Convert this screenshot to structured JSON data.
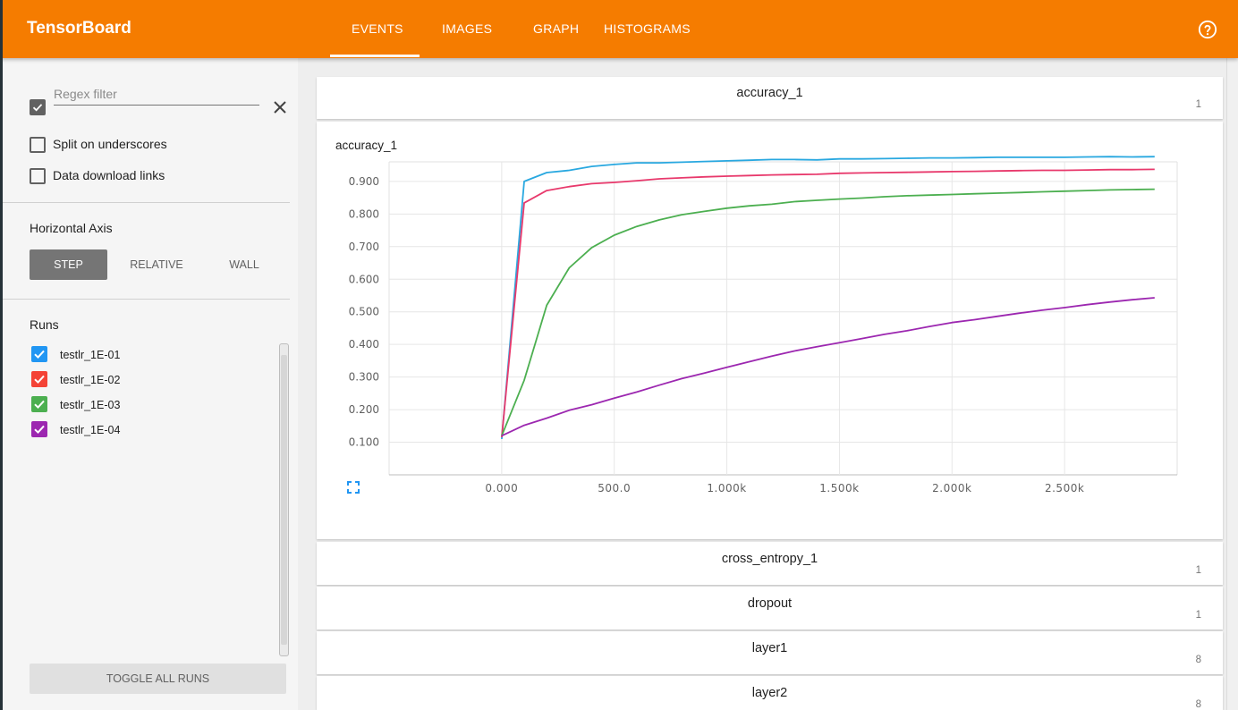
{
  "header": {
    "brand": "TensorBoard",
    "tabs": [
      {
        "label": "EVENTS",
        "active": true
      },
      {
        "label": "IMAGES",
        "active": false
      },
      {
        "label": "GRAPH",
        "active": false
      },
      {
        "label": "HISTOGRAMS",
        "active": false
      }
    ],
    "help_icon": "help-circle-icon",
    "accent_color": "#f57c00"
  },
  "sidebar": {
    "regex_placeholder": "Regex filter",
    "regex_checked": true,
    "options": [
      {
        "label": "Split on underscores",
        "checked": false
      },
      {
        "label": "Data download links",
        "checked": false
      }
    ],
    "horizontal_axis_title": "Horizontal Axis",
    "axis_buttons": [
      {
        "label": "STEP",
        "active": true
      },
      {
        "label": "RELATIVE",
        "active": false
      },
      {
        "label": "WALL",
        "active": false
      }
    ],
    "runs_title": "Runs",
    "runs": [
      {
        "label": "testlr_1E-01",
        "color": "#2196f3",
        "checked": true
      },
      {
        "label": "testlr_1E-02",
        "color": "#f44336",
        "checked": true
      },
      {
        "label": "testlr_1E-03",
        "color": "#4caf50",
        "checked": true
      },
      {
        "label": "testlr_1E-04",
        "color": "#9c27b0",
        "checked": true
      }
    ],
    "toggle_all_label": "TOGGLE ALL RUNS"
  },
  "categories": [
    {
      "title": "accuracy_1",
      "count": "1",
      "expanded": true
    },
    {
      "title": "cross_entropy_1",
      "count": "1",
      "expanded": false
    },
    {
      "title": "dropout",
      "count": "1",
      "expanded": false
    },
    {
      "title": "layer1",
      "count": "8",
      "expanded": false
    },
    {
      "title": "layer2",
      "count": "8",
      "expanded": false
    }
  ],
  "chart_data": {
    "type": "line",
    "title": "accuracy_1",
    "xlabel": "",
    "ylabel": "",
    "xlim": [
      -500,
      3000
    ],
    "ylim": [
      0.0,
      0.96
    ],
    "x_tick_labels": [
      "0.000",
      "500.0",
      "1.000k",
      "1.500k",
      "2.000k",
      "2.500k"
    ],
    "x_tick_values": [
      0,
      500,
      1000,
      1500,
      2000,
      2500
    ],
    "y_tick_labels": [
      "0.100",
      "0.200",
      "0.300",
      "0.400",
      "0.500",
      "0.600",
      "0.700",
      "0.800",
      "0.900"
    ],
    "y_tick_values": [
      0.1,
      0.2,
      0.3,
      0.4,
      0.5,
      0.6,
      0.7,
      0.8,
      0.9
    ],
    "grid": true,
    "series": [
      {
        "name": "testlr_1E-01",
        "color": "#29a8e0",
        "x": [
          0,
          100,
          200,
          300,
          400,
          500,
          600,
          700,
          800,
          900,
          1000,
          1100,
          1200,
          1300,
          1400,
          1500,
          1600,
          1700,
          1800,
          1900,
          2000,
          2100,
          2200,
          2300,
          2400,
          2500,
          2600,
          2700,
          2800,
          2900
        ],
        "y": [
          0.11,
          0.9,
          0.927,
          0.934,
          0.946,
          0.952,
          0.957,
          0.957,
          0.959,
          0.961,
          0.963,
          0.965,
          0.967,
          0.967,
          0.966,
          0.969,
          0.969,
          0.97,
          0.971,
          0.972,
          0.972,
          0.973,
          0.974,
          0.974,
          0.974,
          0.974,
          0.975,
          0.976,
          0.975,
          0.976
        ]
      },
      {
        "name": "testlr_1E-02",
        "color": "#e8396c",
        "x": [
          0,
          100,
          200,
          300,
          400,
          500,
          600,
          700,
          800,
          900,
          1000,
          1100,
          1200,
          1300,
          1400,
          1500,
          1600,
          1700,
          1800,
          1900,
          2000,
          2100,
          2200,
          2300,
          2400,
          2500,
          2600,
          2700,
          2800,
          2900
        ],
        "y": [
          0.115,
          0.834,
          0.872,
          0.884,
          0.893,
          0.897,
          0.902,
          0.908,
          0.911,
          0.914,
          0.916,
          0.918,
          0.92,
          0.921,
          0.922,
          0.925,
          0.926,
          0.927,
          0.928,
          0.929,
          0.93,
          0.931,
          0.932,
          0.933,
          0.934,
          0.934,
          0.935,
          0.936,
          0.936,
          0.937
        ]
      },
      {
        "name": "testlr_1E-03",
        "color": "#4caf50",
        "x": [
          0,
          100,
          200,
          300,
          400,
          500,
          600,
          700,
          800,
          900,
          1000,
          1100,
          1200,
          1300,
          1400,
          1500,
          1600,
          1700,
          1800,
          1900,
          2000,
          2100,
          2200,
          2300,
          2400,
          2500,
          2600,
          2700,
          2800,
          2900
        ],
        "y": [
          0.12,
          0.29,
          0.52,
          0.635,
          0.697,
          0.735,
          0.762,
          0.782,
          0.798,
          0.808,
          0.818,
          0.825,
          0.83,
          0.838,
          0.842,
          0.846,
          0.849,
          0.853,
          0.856,
          0.858,
          0.86,
          0.862,
          0.864,
          0.866,
          0.868,
          0.87,
          0.872,
          0.874,
          0.875,
          0.876
        ]
      },
      {
        "name": "testlr_1E-04",
        "color": "#9c27b0",
        "x": [
          0,
          100,
          200,
          300,
          400,
          500,
          600,
          700,
          800,
          900,
          1000,
          1100,
          1200,
          1300,
          1400,
          1500,
          1600,
          1700,
          1800,
          1900,
          2000,
          2100,
          2200,
          2300,
          2400,
          2500,
          2600,
          2700,
          2800,
          2900
        ],
        "y": [
          0.12,
          0.152,
          0.174,
          0.198,
          0.215,
          0.235,
          0.254,
          0.275,
          0.295,
          0.312,
          0.33,
          0.347,
          0.364,
          0.38,
          0.393,
          0.405,
          0.418,
          0.431,
          0.442,
          0.455,
          0.467,
          0.476,
          0.486,
          0.496,
          0.505,
          0.513,
          0.522,
          0.53,
          0.537,
          0.543
        ]
      }
    ]
  }
}
